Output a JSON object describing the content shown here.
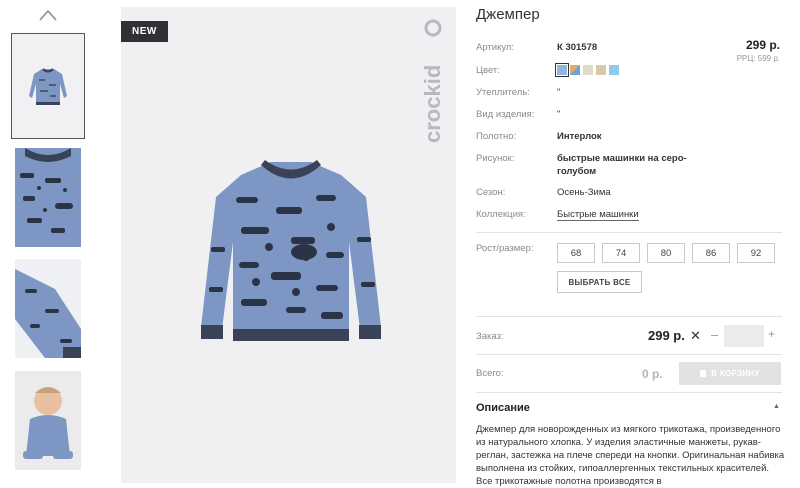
{
  "gallery": {
    "up_icon": "chevron-up-icon",
    "badge": "NEW",
    "brand": "crockid",
    "colors": {
      "sweater": "#7e96c4",
      "print": "#2b3347",
      "cuff": "#3a4257",
      "background": "#f0f0f2"
    }
  },
  "product": {
    "title": "Джемпер",
    "price": "299 р.",
    "rrc": "РРЦ: 599 р.",
    "attributes": [
      {
        "label": "Артикул:",
        "value": "К 301578"
      },
      {
        "label": "Цвет:"
      },
      {
        "label": "Утеплитель:",
        "value": "\""
      },
      {
        "label": "Вид изделия:",
        "value": "\""
      },
      {
        "label": "Полотно:",
        "value": "Интерлок"
      },
      {
        "label": "Рисунок:",
        "value_line1": "быстрые машинки на серо-",
        "value_line2": "голубом"
      },
      {
        "label": "Сезон:",
        "value": "Осень-Зима"
      },
      {
        "label": "Коллекция:",
        "value": "Быстрые машинки"
      }
    ],
    "swatches": [
      "#8fb5e0",
      "#e8a860",
      "#e2dac8",
      "#d8cba8",
      "#8ccaf0"
    ],
    "size_label": "Рост/размер:",
    "sizes": [
      "68",
      "74",
      "80",
      "86",
      "92"
    ],
    "select_all": "ВЫБРАТЬ ВСЕ"
  },
  "order": {
    "label": "Заказ:",
    "price": "299 р.",
    "remove": "✕",
    "minus": "–",
    "quantity": "",
    "plus": "+",
    "total_label": "Всего:",
    "total_value": "0 р.",
    "cart_button": "В КОРЗИНУ"
  },
  "description": {
    "heading": "Описание",
    "toggle": "▲",
    "text": "Джемпер для новорожденных из мягкого трикотажа, произведенного из натурального хлопка. У изделия эластичные манжеты, рукав- реглан, застежка на плече спереди на кнопки. Оригинальная набивка выполнена из стойких, гипоаллергенных текстильных красителей. Все трикотажные полотна производятся в"
  }
}
